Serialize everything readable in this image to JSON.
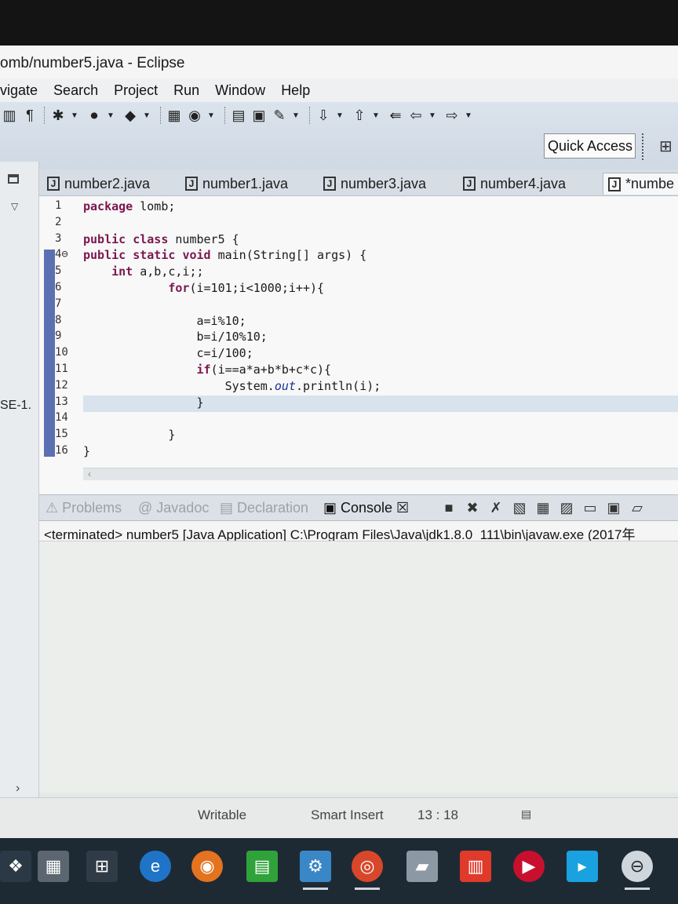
{
  "window": {
    "title": "omb/number5.java - Eclipse"
  },
  "menu": [
    "vigate",
    "Search",
    "Project",
    "Run",
    "Window",
    "Help"
  ],
  "toolbar": {
    "quick_access": "Quick Access"
  },
  "left_panel": {
    "label": "SE-1."
  },
  "editor_tabs": [
    {
      "label": "number2.java"
    },
    {
      "label": "number1.java"
    },
    {
      "label": "number3.java"
    },
    {
      "label": "number4.java"
    },
    {
      "label": "*numbe",
      "active": true
    }
  ],
  "code": {
    "current_line": 13,
    "lines": [
      {
        "n": "1",
        "text": "package lomb;"
      },
      {
        "n": "2",
        "text": ""
      },
      {
        "n": "3",
        "text": "public class number5 {"
      },
      {
        "n": "4⊖",
        "text": "public static void main(String[] args) {"
      },
      {
        "n": "5",
        "text": "    int a,b,c,i;;"
      },
      {
        "n": "6",
        "text": "            for(i=101;i<1000;i++){"
      },
      {
        "n": "7",
        "text": ""
      },
      {
        "n": "8",
        "text": "                a=i%10;"
      },
      {
        "n": "9",
        "text": "                b=i/10%10;"
      },
      {
        "n": "10",
        "text": "                c=i/100;"
      },
      {
        "n": "11",
        "text": "                if(i==a*a+b*b+c*c){"
      },
      {
        "n": "12",
        "text": "                    System.out.println(i);"
      },
      {
        "n": "13",
        "text": "                }"
      },
      {
        "n": "14",
        "text": ""
      },
      {
        "n": "15",
        "text": "            }"
      },
      {
        "n": "16",
        "text": "}"
      }
    ]
  },
  "bottom_tabs": [
    {
      "label": "Problems"
    },
    {
      "label": "Javadoc"
    },
    {
      "label": "Declaration"
    },
    {
      "label": "Console ☒",
      "active": true
    }
  ],
  "console": {
    "status": "<terminated> number5 [Java Application] C:\\Program Files\\Java\\jdk1.8.0_111\\bin\\javaw.exe (2017年"
  },
  "statusbar": {
    "writable": "Writable",
    "insert_mode": "Smart Insert",
    "position": "13 : 18"
  }
}
